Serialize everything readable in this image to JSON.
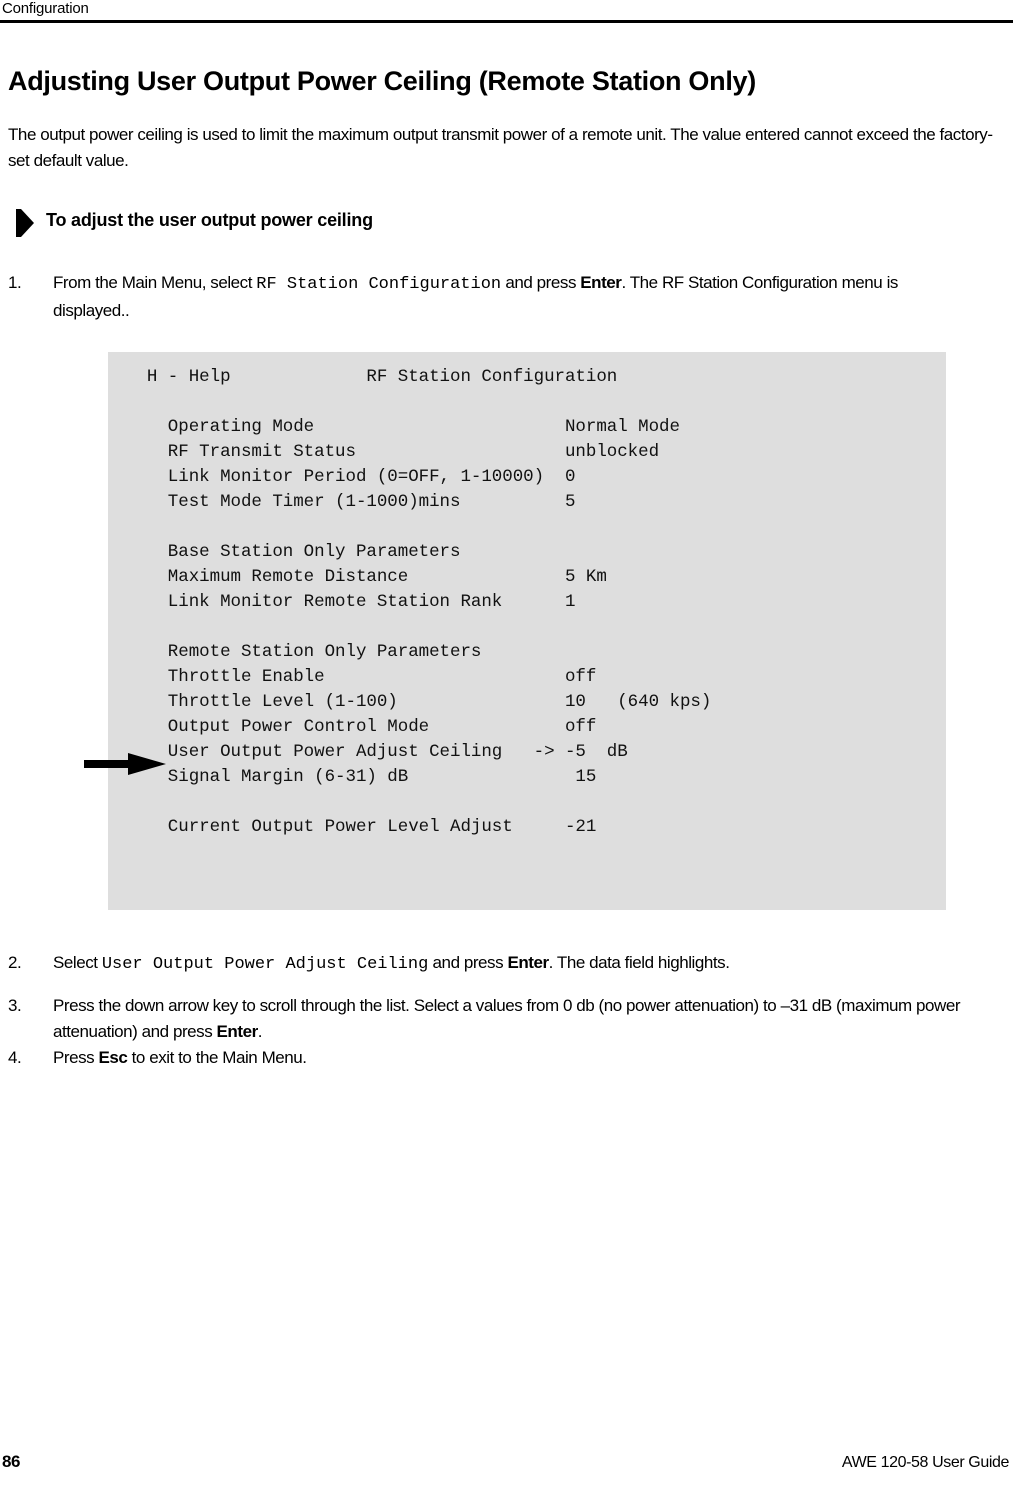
{
  "header": {
    "running_head": "Configuration"
  },
  "title": "Adjusting User Output Power Ceiling (Remote Station Only)",
  "intro": "The output power ceiling is used to limit the maximum output transmit power of a remote unit. The value entered cannot exceed the factory-set default value.",
  "procedure": {
    "heading": "To adjust the user output power ceiling",
    "steps": [
      {
        "number": "1.",
        "parts": [
          {
            "text": "From the Main Menu, select ",
            "style": "normal"
          },
          {
            "text": "RF Station Configuration",
            "style": "mono"
          },
          {
            "text": " and press ",
            "style": "normal"
          },
          {
            "text": "Enter",
            "style": "bold"
          },
          {
            "text": ". The RF Station Configuration menu is displayed..",
            "style": "normal"
          }
        ]
      },
      {
        "number": "2.",
        "parts": [
          {
            "text": "Select ",
            "style": "normal"
          },
          {
            "text": "User Output Power Adjust Ceiling",
            "style": "mono"
          },
          {
            "text": " and press ",
            "style": "normal"
          },
          {
            "text": "Enter",
            "style": "bold"
          },
          {
            "text": ". The data field highlights.",
            "style": "normal"
          }
        ]
      },
      {
        "number": "3.",
        "parts": [
          {
            "text": "Press the down arrow key to scroll through the list. Select a values from 0 db (no power attenuation) to –31 dB (maximum power attenuation) and press ",
            "style": "normal"
          },
          {
            "text": "Enter",
            "style": "bold"
          },
          {
            "text": ".",
            "style": "normal"
          }
        ]
      },
      {
        "number": "4.",
        "parts": [
          {
            "text": "Press ",
            "style": "normal"
          },
          {
            "text": "Esc",
            "style": "bold"
          },
          {
            "text": " to exit to the Main Menu.",
            "style": "normal"
          }
        ]
      }
    ]
  },
  "terminal": {
    "background_color": "#dedede",
    "help_hint": "H - Help",
    "screen_title": "RF Station Configuration",
    "lines": [
      {
        "id": "help-title",
        "text": "  H - Help             RF Station Configuration"
      },
      {
        "id": "blank-1",
        "text": ""
      },
      {
        "id": "operating-mode",
        "text": "    Operating Mode                        Normal Mode"
      },
      {
        "id": "rf-transmit",
        "text": "    RF Transmit Status                    unblocked"
      },
      {
        "id": "link-monitor",
        "text": "    Link Monitor Period (0=OFF, 1-10000)  0"
      },
      {
        "id": "test-mode-timer",
        "text": "    Test Mode Timer (1-1000)mins          5"
      },
      {
        "id": "blank-2",
        "text": ""
      },
      {
        "id": "base-station-hdr",
        "text": "    Base Station Only Parameters"
      },
      {
        "id": "max-remote-dist",
        "text": "    Maximum Remote Distance               5 Km"
      },
      {
        "id": "link-mon-rank",
        "text": "    Link Monitor Remote Station Rank      1"
      },
      {
        "id": "blank-3",
        "text": ""
      },
      {
        "id": "remote-hdr",
        "text": "    Remote Station Only Parameters"
      },
      {
        "id": "throttle-enable",
        "text": "    Throttle Enable                       off"
      },
      {
        "id": "throttle-level",
        "text": "    Throttle Level (1-100)                10   (640 kps)"
      },
      {
        "id": "out-pwr-ctrl",
        "text": "    Output Power Control Mode             off"
      },
      {
        "id": "user-out-ceiling",
        "text": "    User Output Power Adjust Ceiling   -> -5  dB"
      },
      {
        "id": "signal-margin",
        "text": "    Signal Margin (6-31) dB                15"
      },
      {
        "id": "blank-4",
        "text": ""
      },
      {
        "id": "cur-out-pwr",
        "text": "    Current Output Power Level Adjust     -21"
      }
    ],
    "selection_marker": "->",
    "highlighted_field": "User Output Power Adjust Ceiling",
    "highlighted_value": "-5  dB"
  },
  "footer": {
    "page_number": "86",
    "guide_name": "AWE 120-58 User Guide"
  }
}
